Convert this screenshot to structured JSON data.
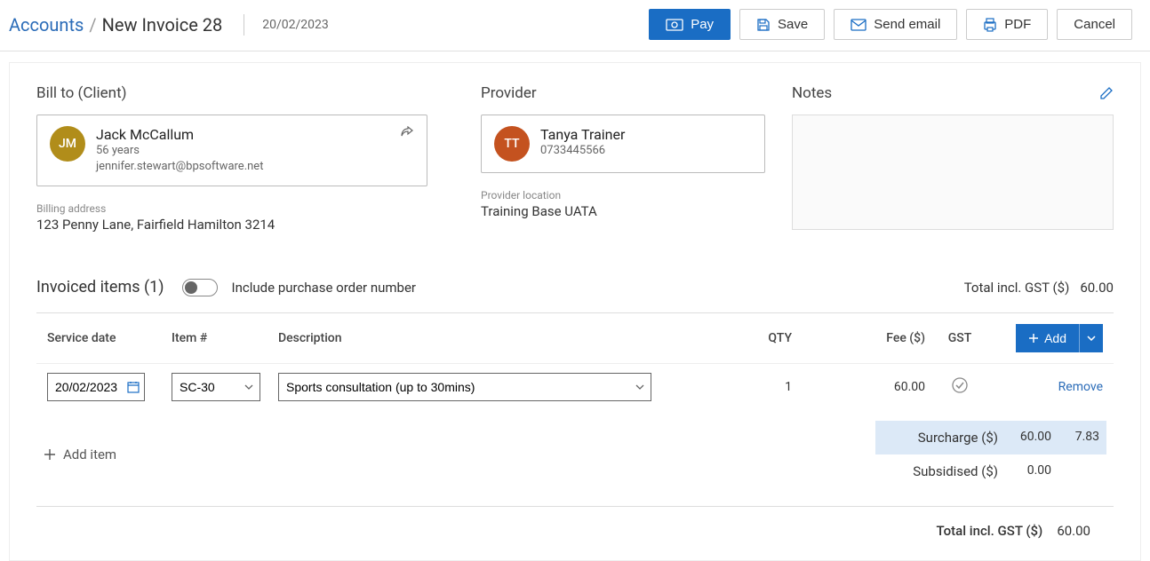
{
  "breadcrumb": {
    "root": "Accounts",
    "current": "New Invoice 28"
  },
  "header_date": "20/02/2023",
  "actions": {
    "pay": "Pay",
    "save": "Save",
    "send_email": "Send email",
    "pdf": "PDF",
    "cancel": "Cancel"
  },
  "client": {
    "section": "Bill to (Client)",
    "initials": "JM",
    "name": "Jack McCallum",
    "age": "56 years",
    "email": "jennifer.stewart@bpsoftware.net",
    "address_label": "Billing address",
    "address": "123 Penny Lane, Fairfield Hamilton 3214"
  },
  "provider": {
    "section": "Provider",
    "initials": "TT",
    "name": "Tanya Trainer",
    "phone": "0733445566",
    "location_label": "Provider location",
    "location": "Training Base UATA"
  },
  "notes": {
    "section": "Notes",
    "value": ""
  },
  "items_section": {
    "title": "Invoiced items (1)",
    "toggle_label": "Include purchase order number",
    "top_total_label": "Total incl. GST ($)",
    "top_total_value": "60.00"
  },
  "table": {
    "headers": {
      "sd": "Service date",
      "item": "Item #",
      "desc": "Description",
      "qty": "QTY",
      "fee": "Fee ($)",
      "gst": "GST"
    },
    "add_button": "Add",
    "remove": "Remove",
    "rows": [
      {
        "service_date": "20/02/2023",
        "item_code": "SC-30",
        "description": "Sports consultation (up to 30mins)",
        "qty": "1",
        "fee": "60.00",
        "gst": true
      }
    ],
    "add_item": "Add item"
  },
  "totals": {
    "surcharge_label": "Surcharge ($)",
    "surcharge": "60.00",
    "surcharge_gst": "7.83",
    "subsidised_label": "Subsidised ($)",
    "subsidised": "0.00",
    "grand_label": "Total incl. GST ($)",
    "grand": "60.00"
  }
}
